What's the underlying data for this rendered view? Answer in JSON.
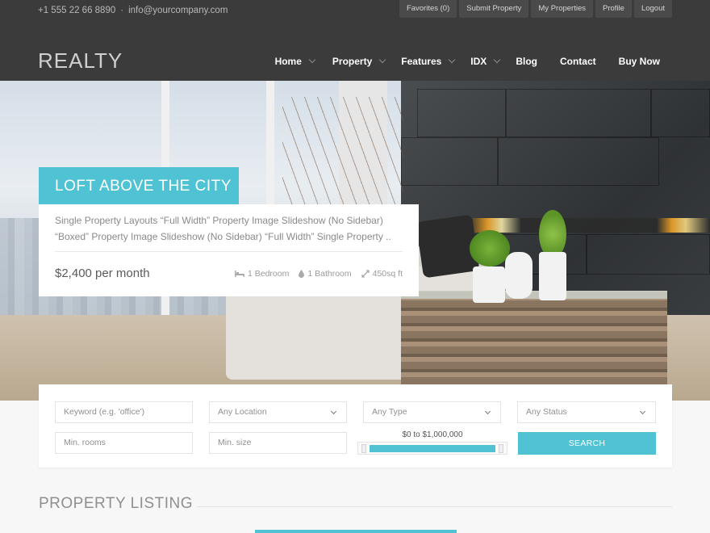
{
  "topbar": {
    "phone": "+1 555 22 66 8890",
    "separator": "·",
    "email": "info@yourcompany.com",
    "links": [
      "Favorites (0)",
      "Submit Property",
      "My Properties",
      "Profile",
      "Logout"
    ]
  },
  "brand": {
    "logo": "REALTY"
  },
  "nav": {
    "home": "Home",
    "property": "Property",
    "features": "Features",
    "idx": "IDX",
    "blog": "Blog",
    "contact": "Contact",
    "buy_now": "Buy Now"
  },
  "featured": {
    "title": "LOFT ABOVE THE CITY",
    "description": "Single Property Layouts “Full Width” Property Image Slideshow (No Sidebar) “Boxed” Property Image Slideshow (No Sidebar) “Full Width” Single Property ..",
    "price": "$2,400 per month",
    "bedrooms": "1 Bedroom",
    "bathrooms": "1 Bathroom",
    "size": "450sq ft"
  },
  "search": {
    "keyword_placeholder": "Keyword (e.g. 'office')",
    "location": "Any Location",
    "type": "Any Type",
    "status": "Any Status",
    "min_rooms_placeholder": "Min. rooms",
    "min_size_placeholder": "Min. size",
    "price_range": "$0 to $1,000,000",
    "price_range_fill_fraction": 1.0,
    "button": "SEARCH"
  },
  "listing": {
    "title": "PROPERTY LISTING"
  },
  "colors": {
    "accent": "#4fc3d3",
    "header_bg": "#3b3b3b",
    "page_bg": "#f7f7f7"
  },
  "icons": {
    "bed": "bed-icon",
    "bath": "drop-icon",
    "size": "resize-arrows-icon"
  }
}
